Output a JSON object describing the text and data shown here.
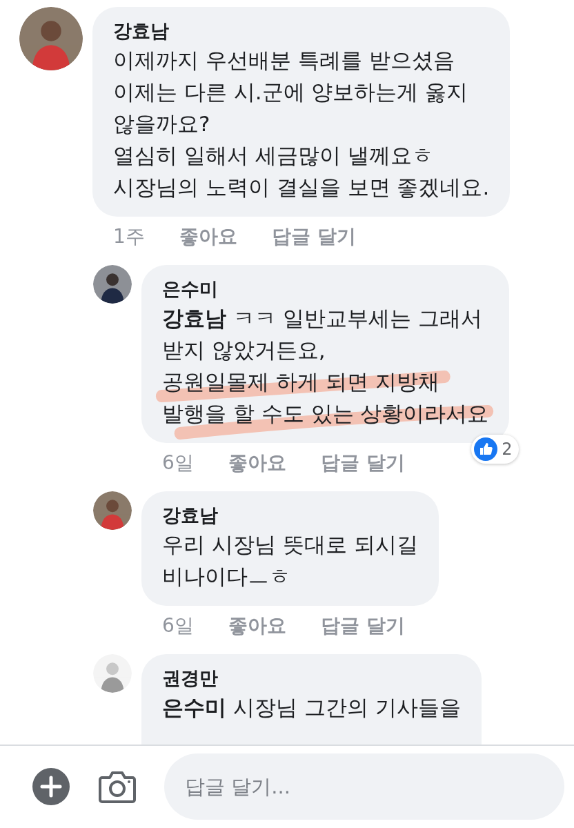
{
  "comments": [
    {
      "author": "강효남",
      "reply": false,
      "text": "이제까지 우선배분 특례를 받으셨음\n이제는 다른 시.군에 양보하는게 옳지\n않을까요?\n열심히 일해서 세금많이 낼께요ㅎ\n시장님의 노력이 결실을 보면 좋겠네요.",
      "time": "1주",
      "like": "좋아요",
      "reply_action": "답글 달기",
      "highlighted": false
    },
    {
      "author": "은수미",
      "reply": true,
      "text": "**강효남** ㅋㅋ 일반교부세는 그래서\n받지 않았거든요,\n공원일몰제 하게 되면 지방채\n발행을 할 수도 있는 상황이라서요",
      "time": "6일",
      "like": "좋아요",
      "reply_action": "답글 달기",
      "highlighted": true,
      "reactions": "2"
    },
    {
      "author": "강효남",
      "reply": true,
      "text": "우리 시장님 뜻대로 되시길\n비나이다ㅡㅎ",
      "time": "6일",
      "like": "좋아요",
      "reply_action": "답글 달기",
      "highlighted": false
    },
    {
      "author": "권경만",
      "reply": true,
      "text": "**은수미** 시장님 그간의 기사들을",
      "highlighted": false
    }
  ],
  "composer": {
    "placeholder": "답글 달기..."
  }
}
